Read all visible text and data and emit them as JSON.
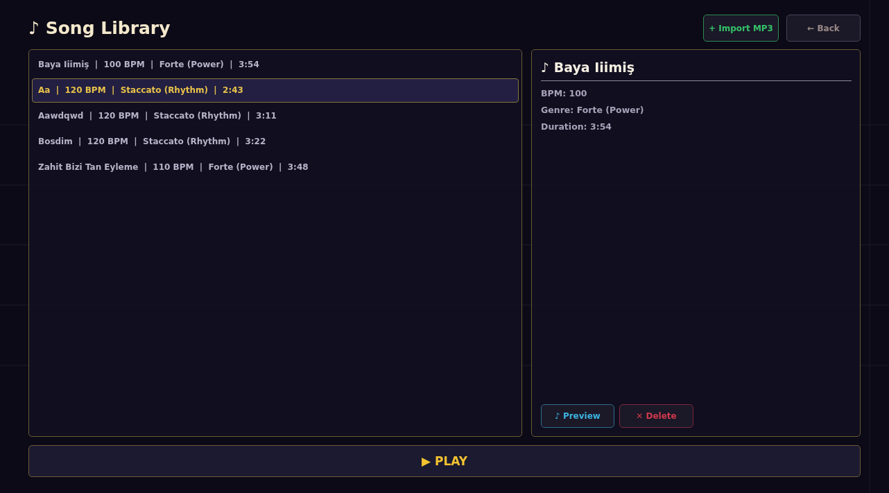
{
  "header": {
    "title": "♪ Song Library",
    "buttons": [
      {
        "label": "+ Import MP3",
        "kind": "import"
      },
      {
        "label": "← Back",
        "kind": "back"
      }
    ]
  },
  "songs": [
    {
      "text": "Baya Iiimiş  |  100 BPM  |  Forte (Power)  |  3:54",
      "selected": false
    },
    {
      "text": "Aa  |  120 BPM  |  Staccato (Rhythm)  |  2:43",
      "selected": true
    },
    {
      "text": "Aawdqwd  |  120 BPM  |  Staccato (Rhythm)  |  3:11",
      "selected": false
    },
    {
      "text": "Bosdim  |  120 BPM  |  Staccato (Rhythm)  |  3:22",
      "selected": false
    },
    {
      "text": "Zahit Bizi Tan Eyleme  |  110 BPM  |  Forte (Power)  |  3:48",
      "selected": false
    }
  ],
  "details": {
    "title": "♪ Baya Iiimiş",
    "fields": [
      "BPM: 100",
      "Genre: Forte (Power)",
      "Duration: 3:54"
    ],
    "buttons": [
      {
        "label": "♪ Preview",
        "kind": "preview"
      },
      {
        "label": "✕ Delete",
        "kind": "delete"
      }
    ]
  },
  "play_button": "▶ PLAY"
}
